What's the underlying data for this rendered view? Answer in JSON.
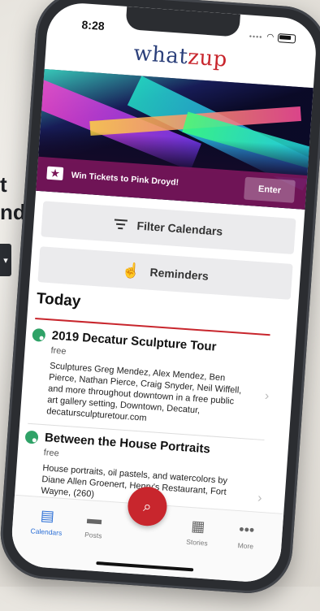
{
  "status_bar": {
    "time": "8:28"
  },
  "app": {
    "brand_what": "what",
    "brand_zup": "zup"
  },
  "hero": {
    "promo_text": "Win Tickets to Pink Droyd!",
    "enter_label": "Enter"
  },
  "actions": {
    "filter_label": "Filter Calendars",
    "reminders_label": "Reminders"
  },
  "section": {
    "title": "Today"
  },
  "events": [
    {
      "title": "2019 Decatur Sculpture Tour",
      "price": "free",
      "description": "Sculptures Greg Mendez, Alex Mendez, Ben Pierce, Nathan Pierce, Craig Snyder, Neil Wiffell, and more throughout downtown in a free public art gallery setting, Downtown, Decatur, decatursculpturetour.com"
    },
    {
      "title": "Between the House Portraits",
      "price": "free",
      "description": "House portraits, oil pastels, and watercolors by Diane Allen Groenert, Henry's Restaurant, Fort Wayne, (260)"
    }
  ],
  "tabbar": {
    "calendars": "Calendars",
    "posts": "Posts",
    "stories": "Stories",
    "more": "More"
  },
  "background": {
    "line1": "t",
    "line2": "nd"
  },
  "colors": {
    "brand_blue": "#2b3f7a",
    "brand_red": "#c8262d",
    "tab_active": "#2b6fd6",
    "promo_bar": "#78165a"
  },
  "icons": [
    "ticket-icon",
    "filter-icon",
    "hand-tap-icon",
    "palette-icon",
    "chevron-right-icon",
    "calendar-icon",
    "posts-icon",
    "search-icon",
    "stories-icon",
    "more-icon"
  ]
}
